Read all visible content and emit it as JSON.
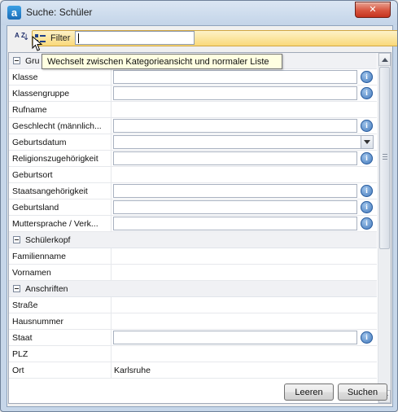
{
  "window": {
    "title": "Suche: Schüler",
    "close_glyph": "✕",
    "app_icon_letter": "a"
  },
  "toolbar": {
    "sort_button_glyph": "A Z",
    "filter_label": "Filter",
    "filter_value": ""
  },
  "tooltip": "Wechselt zwischen Kategorieansicht und normaler Liste",
  "grid": {
    "categories": [
      {
        "label": "Gru"
      },
      {
        "label": "Schülerkopf"
      },
      {
        "label": "Anschriften"
      }
    ],
    "rows": [
      {
        "name": "Klasse",
        "value": ""
      },
      {
        "name": "Klassengruppe",
        "value": ""
      },
      {
        "name": "Rufname",
        "value": ""
      },
      {
        "name": "Geschlecht (männlich...",
        "value": ""
      },
      {
        "name": "Geburtsdatum",
        "value": ""
      },
      {
        "name": "Religionszugehörigkeit",
        "value": ""
      },
      {
        "name": "Geburtsort",
        "value": ""
      },
      {
        "name": "Staatsangehörigkeit",
        "value": ""
      },
      {
        "name": "Geburtsland",
        "value": ""
      },
      {
        "name": "Muttersprache / Verk...",
        "value": ""
      },
      {
        "name": "Familienname",
        "value": ""
      },
      {
        "name": "Vornamen",
        "value": ""
      },
      {
        "name": "Straße",
        "value": ""
      },
      {
        "name": "Hausnummer",
        "value": ""
      },
      {
        "name": "Staat",
        "value": ""
      },
      {
        "name": "PLZ",
        "value": ""
      },
      {
        "name": "Ort",
        "value": "Karlsruhe"
      }
    ],
    "info_glyph": "i"
  },
  "buttons": {
    "clear": "Leeren",
    "search": "Suchen"
  },
  "colors": {
    "close_button": "#c5331e",
    "tooltip_bg": "#ffffe1",
    "info_icon": "#3a72b8",
    "title_bar": "#c6d6e9"
  }
}
